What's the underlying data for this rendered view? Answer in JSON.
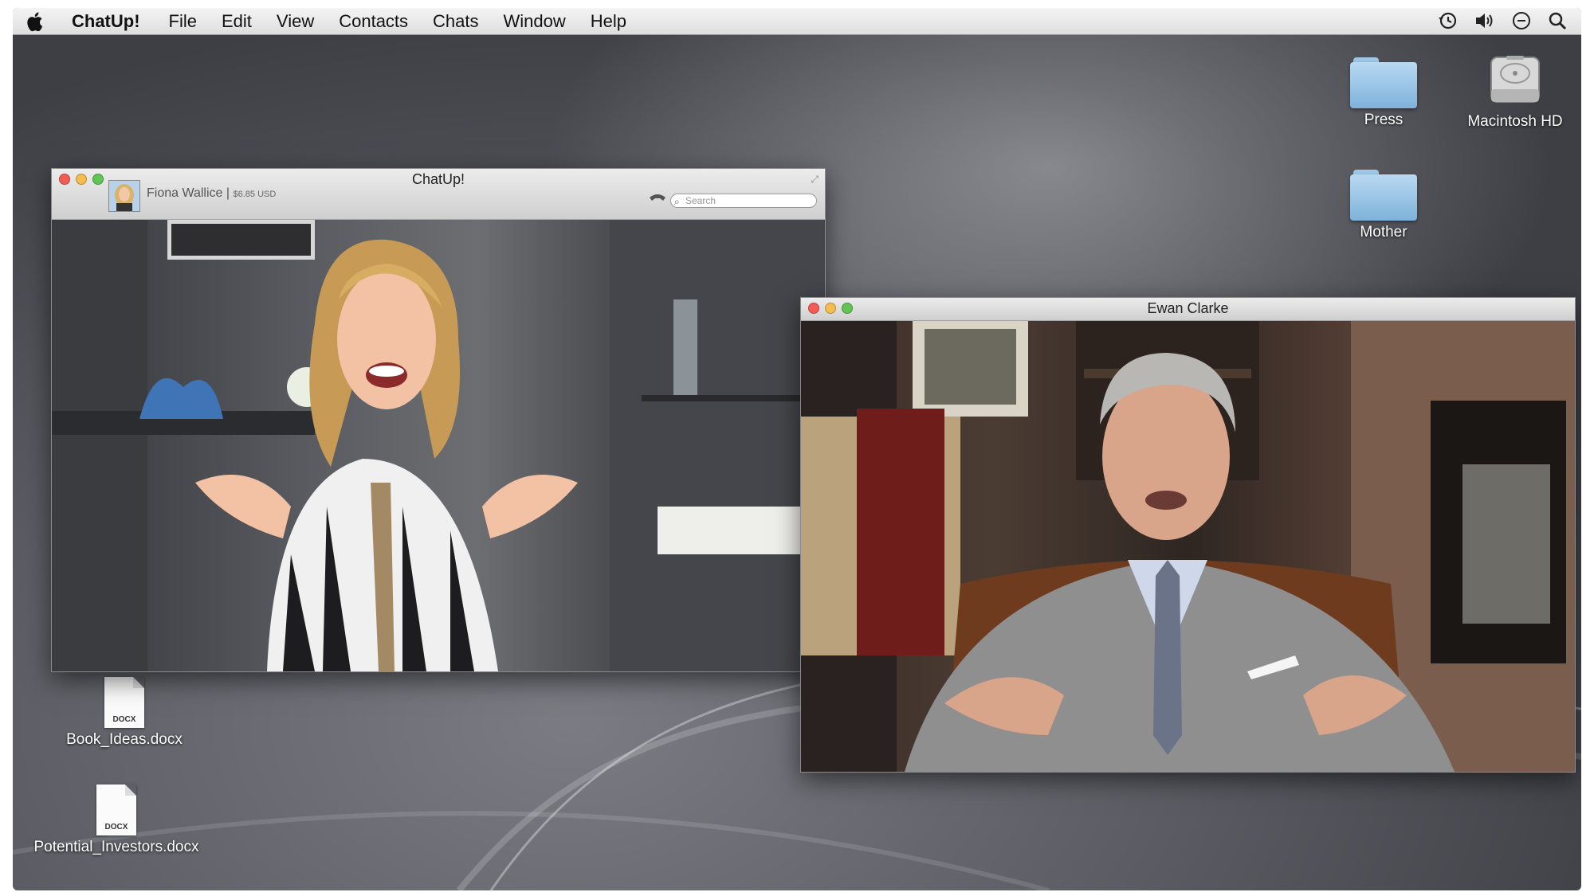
{
  "menubar": {
    "app_name": "ChatUp!",
    "menus": [
      "File",
      "Edit",
      "View",
      "Contacts",
      "Chats",
      "Window",
      "Help"
    ],
    "status_icons": [
      "time-machine-icon",
      "volume-icon",
      "sync-icon",
      "spotlight-search-icon"
    ]
  },
  "desktop": {
    "icons": [
      {
        "label": "Press",
        "kind": "folder-icon"
      },
      {
        "label": "Macintosh HD",
        "kind": "hard-drive-icon"
      },
      {
        "label": "Mother",
        "kind": "folder-icon"
      },
      {
        "label": "Book_Ideas.docx",
        "kind": "docx-file-icon",
        "ext": "DOCX"
      },
      {
        "label": "Potential_Investors.docx",
        "kind": "docx-file-icon",
        "ext": "DOCX"
      }
    ]
  },
  "chat_window": {
    "title": "ChatUp!",
    "contact_name": "Fiona Wallice",
    "separator": "|",
    "balance": "$6.85 USD",
    "search_placeholder": "Search"
  },
  "call_window": {
    "title": "Ewan Clarke"
  }
}
